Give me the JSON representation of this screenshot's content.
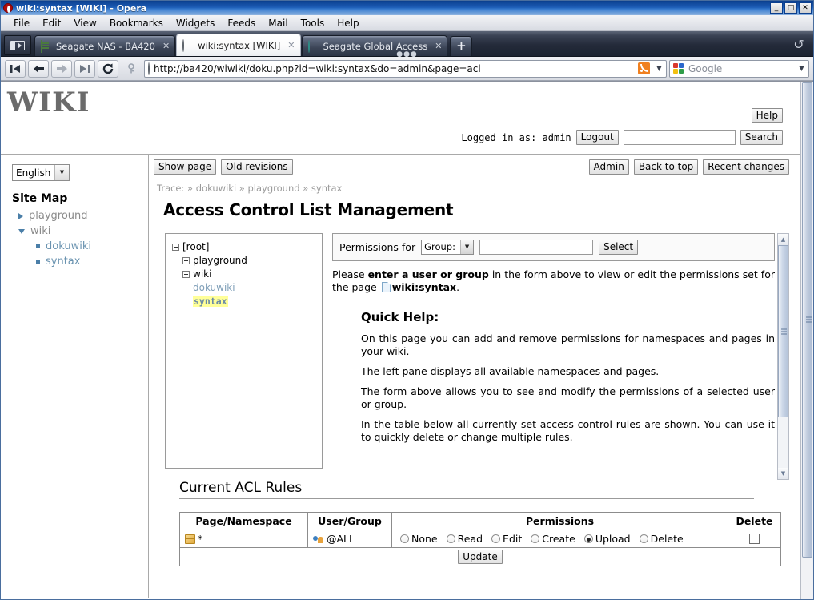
{
  "window": {
    "title": "wiki:syntax [WIKI] - Opera",
    "controls": {
      "minimize": "_",
      "maximize": "□",
      "close": "✕"
    }
  },
  "menubar": {
    "items": [
      "File",
      "Edit",
      "View",
      "Bookmarks",
      "Widgets",
      "Feeds",
      "Mail",
      "Tools",
      "Help"
    ]
  },
  "tabbar": {
    "panel_toggle": "panel-toggle",
    "new_tab_label": "+",
    "tabs": [
      {
        "label": "Seagate NAS - BA420",
        "icon": "document-icon",
        "active": false,
        "close": "✕"
      },
      {
        "label": "wiki:syntax [WIKI]",
        "icon": "opera-page-icon",
        "active": true,
        "close": "✕"
      },
      {
        "label": "Seagate Global Access",
        "icon": "globe-icon",
        "active": false,
        "close": "✕"
      }
    ],
    "trash_icon": "trash-restore-icon"
  },
  "navbar": {
    "buttons": [
      {
        "name": "rewind-button",
        "glyph": "▐◀"
      },
      {
        "name": "back-button",
        "glyph": "←"
      },
      {
        "name": "forward-button",
        "glyph": "→"
      },
      {
        "name": "fast-forward-button",
        "glyph": "▶▌"
      },
      {
        "name": "reload-button",
        "glyph": "↻"
      },
      {
        "name": "wand-button",
        "glyph": "⚷"
      }
    ],
    "url": "http://ba420/wiwiki/doku.php?id=wiki:syntax&do=admin&page=acl",
    "rss_icon": "rss-icon",
    "url_dropdown": "▼",
    "search_placeholder": "Google",
    "search_value": "",
    "search_dropdown": "▼"
  },
  "wiki": {
    "logo": "WIKI",
    "help_button": "Help",
    "logged_in_text": "Logged in as: admin",
    "logout_button": "Logout",
    "search_value": "",
    "search_button": "Search"
  },
  "sidebar": {
    "language": {
      "value": "English",
      "caret": "▼"
    },
    "sitemap_title": "Site Map",
    "items": [
      {
        "label": "playground",
        "bullet": "triangle-right",
        "level": 1,
        "style": "plain"
      },
      {
        "label": "wiki",
        "bullet": "triangle-down",
        "level": 1,
        "style": "plain"
      },
      {
        "label": "dokuwiki",
        "bullet": "square",
        "level": 2,
        "style": "link"
      },
      {
        "label": "syntax",
        "bullet": "square",
        "level": 2,
        "style": "link"
      }
    ]
  },
  "toolbar": {
    "left": [
      "Show page",
      "Old revisions"
    ],
    "right": [
      "Admin",
      "Back to top",
      "Recent changes"
    ]
  },
  "trace": {
    "label": "Trace:",
    "sep": "»",
    "items": [
      "dokuwiki",
      "playground",
      "syntax"
    ]
  },
  "main": {
    "title": "Access Control List Management",
    "tree": {
      "root": {
        "label": "[root]",
        "box": "minus"
      },
      "children": [
        {
          "label": "playground",
          "box": "plus",
          "style": "plain",
          "indent": 1
        },
        {
          "label": "wiki",
          "box": "minus",
          "style": "plain",
          "indent": 1
        },
        {
          "label": "dokuwiki",
          "box": "none",
          "style": "link",
          "indent": 2
        },
        {
          "label": "syntax",
          "box": "none",
          "style": "current",
          "indent": 2
        }
      ]
    },
    "perm_form": {
      "label": "Permissions for",
      "select_value": "Group:",
      "select_caret": "▼",
      "input_value": "",
      "select_button": "Select"
    },
    "intro": {
      "before": "Please ",
      "bold": "enter a user or group",
      "middle": " in the form above to view or edit the permissions set for the page ",
      "page_icon": "page-icon",
      "page_name": "wiki:syntax",
      "after": "."
    },
    "quick_help_title": "Quick Help:",
    "quick_help_paragraphs": [
      "On this page you can add and remove permissions for namespaces and pages in your wiki.",
      "The left pane displays all available namespaces and pages.",
      "The form above allows you to see and modify the permissions of a selected user or group.",
      "In the table below all currently set access control rules are shown. You can use it to quickly delete or change multiple rules."
    ],
    "rules_title": "Current ACL Rules",
    "table": {
      "headers": [
        "Page/Namespace",
        "User/Group",
        "Permissions",
        "Delete"
      ],
      "permission_options": [
        "None",
        "Read",
        "Edit",
        "Create",
        "Upload",
        "Delete"
      ],
      "rows": [
        {
          "namespace": "*",
          "namespace_icon": "namespace-icon",
          "user_group": "@ALL",
          "user_group_icon": "group-icon",
          "selected_permission": "Upload",
          "delete_checked": false
        }
      ],
      "update_button": "Update"
    }
  },
  "colors": {
    "titlebar_blue": "#1d5cb5",
    "tabbar_dark": "#2c3445",
    "link_blue": "#6a93b0",
    "highlight_yellow": "#ffff99",
    "accent_orange": "#f08020"
  }
}
